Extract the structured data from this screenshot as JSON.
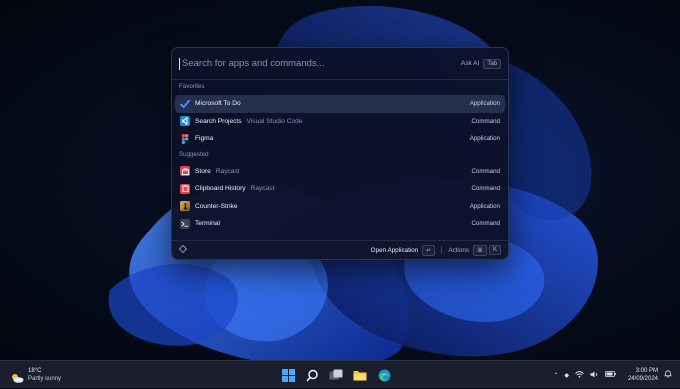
{
  "launcher": {
    "search_placeholder": "Search for apps and commands...",
    "ask_ai_label": "Ask AI",
    "ask_ai_key": "Tab",
    "sections": [
      {
        "title": "Favorites",
        "items": [
          {
            "title": "Microsoft To Do",
            "subtitle": "",
            "type": "Application",
            "icon": "check-icon",
            "color": "#3a6ff2",
            "selected": true
          },
          {
            "title": "Search Projects",
            "subtitle": "Visual Studio Code",
            "type": "Command",
            "icon": "vscode-icon",
            "color": "#1f8ad2",
            "selected": false
          },
          {
            "title": "Figma",
            "subtitle": "",
            "type": "Application",
            "icon": "figma-icon",
            "color": "#1d1d1d",
            "selected": false
          }
        ]
      },
      {
        "title": "Suggested",
        "items": [
          {
            "title": "Store",
            "subtitle": "Raycast",
            "type": "Command",
            "icon": "store-icon",
            "color": "#e5454f",
            "selected": false
          },
          {
            "title": "Clipboard History",
            "subtitle": "Raycast",
            "type": "Command",
            "icon": "clipboard-icon",
            "color": "#e5454f",
            "selected": false
          },
          {
            "title": "Counter-Strike",
            "subtitle": "",
            "type": "Application",
            "icon": "counter-strike-icon",
            "color": "#d9a640",
            "selected": false
          },
          {
            "title": "Terminal",
            "subtitle": "",
            "type": "Command",
            "icon": "terminal-icon",
            "color": "#3c4150",
            "selected": false
          }
        ]
      }
    ],
    "footer": {
      "primary_action": "Open Application",
      "primary_key": "↵",
      "actions_label": "Actions",
      "actions_keys": [
        "⌘",
        "K"
      ]
    }
  },
  "taskbar": {
    "weather_temp": "18°C",
    "weather_desc": "Partly sunny",
    "time": "3:00 PM",
    "date": "24/09/2024"
  }
}
